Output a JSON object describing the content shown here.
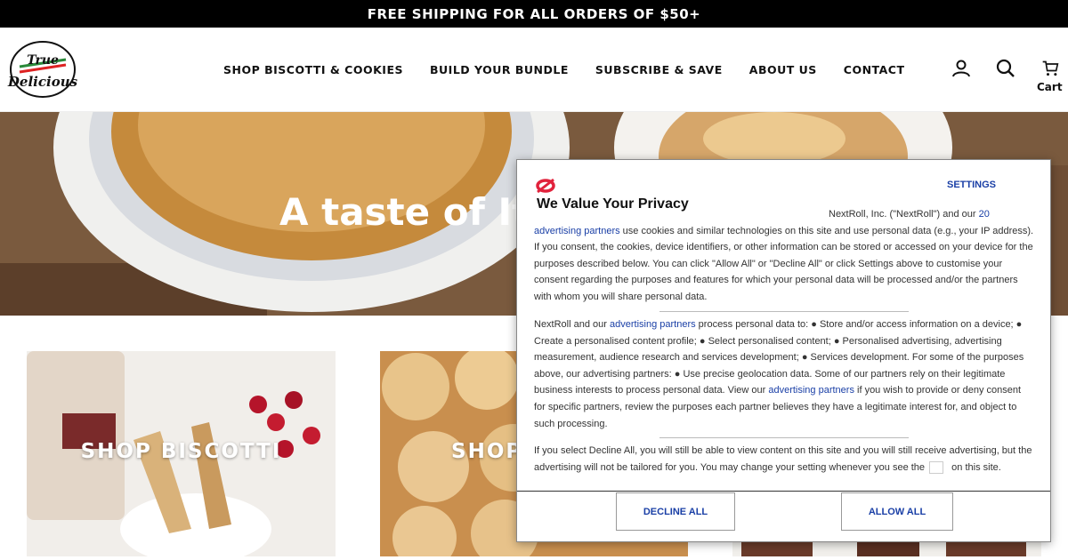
{
  "announcement": "FREE SHIPPING FOR ALL ORDERS OF $50+",
  "logo": {
    "line1": "True",
    "line2": "Delicious"
  },
  "nav": {
    "items": [
      {
        "label": "SHOP BISCOTTI & COOKIES"
      },
      {
        "label": "BUILD YOUR BUNDLE"
      },
      {
        "label": "SUBSCRIBE & SAVE"
      },
      {
        "label": "ABOUT US"
      },
      {
        "label": "CONTACT"
      }
    ]
  },
  "header_icons": {
    "account": "user-icon",
    "search": "search-icon",
    "cart": "cart-icon",
    "cart_label": "Cart"
  },
  "hero": {
    "title": "A taste of Ita"
  },
  "cards": [
    {
      "label": "SHOP BISCOTTI"
    },
    {
      "label": "SHOP"
    },
    {
      "label": ""
    }
  ],
  "privacy": {
    "title": "We Value Your Privacy",
    "settings": "SETTINGS",
    "intro_prefix": "NextRoll, Inc. (\"NextRoll\") and our",
    "intro_link": "20 advertising partners",
    "intro_rest": " use cookies and similar technologies on this site and use personal data (e.g., your IP address). If you consent, the cookies, device identifiers, or other information can be stored or accessed on your device for the purposes described below. You can click \"Allow All\" or \"Decline All\" or click Settings above to customise your consent regarding the purposes and features for which your personal data will be processed and/or the partners with whom you will share personal data.",
    "p2_prefix": "NextRoll and our ",
    "p2_link1": "advertising partners",
    "p2_mid": " process personal data to: ● Store and/or access information on a device; ● Create a personalised content profile; ● Select personalised content; ● Personalised advertising, advertising measurement, audience research and services development; ● Services development. For some of the purposes above, our advertising partners: ● Use precise geolocation data. Some of our partners rely on their legitimate business interests to process personal data. View our ",
    "p2_link2": "advertising partners",
    "p2_rest": " if you wish to provide or deny consent for specific partners, review the purposes each partner believes they have a legitimate interest for, and object to such processing.",
    "p3_prefix": "If you select Decline All, you will still be able to view content on this site and you will still receive advertising, but the advertising will not be tailored for you. You may change your setting whenever you see the ",
    "p3_rest": " on this site.",
    "decline": "DECLINE ALL",
    "allow": "ALLOW ALL"
  },
  "colors": {
    "accent": "#e1223c",
    "link": "#1a3fa6",
    "bar": "#000000"
  }
}
